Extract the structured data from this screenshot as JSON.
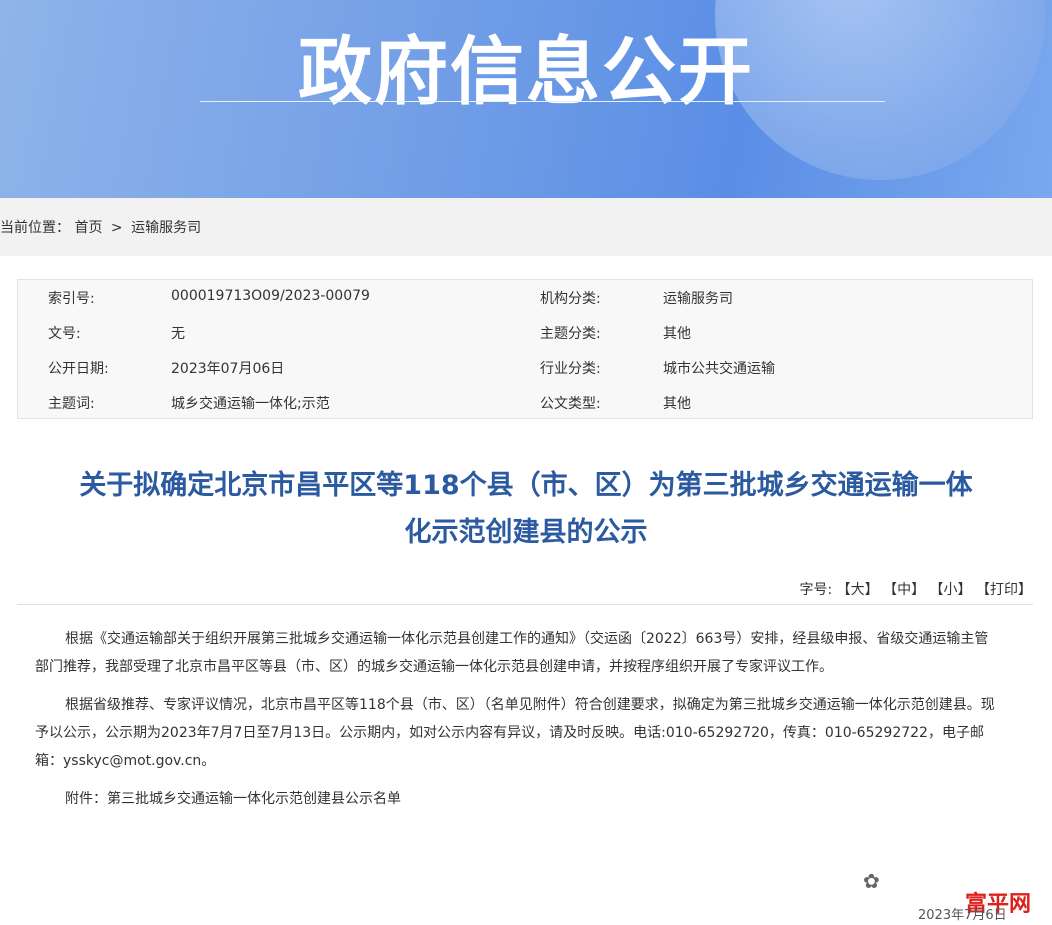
{
  "banner": {
    "title": "政府信息公开"
  },
  "breadcrumb": {
    "prefix": "当前位置：",
    "home": "首页",
    "separator": ">",
    "section": "运输服务司"
  },
  "meta": [
    {
      "k1": "索引号:",
      "v1": "000019713O09/2023-00079",
      "k2": "机构分类:",
      "v2": "运输服务司"
    },
    {
      "k1": "文号:",
      "v1": "无",
      "k2": "主题分类:",
      "v2": "其他"
    },
    {
      "k1": "公开日期:",
      "v1": "2023年07月06日",
      "k2": "行业分类:",
      "v2": "城市公共交通运输"
    },
    {
      "k1": "主题词:",
      "v1": "城乡交通运输一体化;示范",
      "k2": "公文类型:",
      "v2": "其他"
    }
  ],
  "article": {
    "title_line1": "关于拟确定北京市昌平区等118个县（市、区）为第三批城乡交通运输一体",
    "title_line2": "化示范创建县的公示",
    "font_label": "字号:",
    "font_large": "【大】",
    "font_medium": "【中】",
    "font_small": "【小】",
    "print": "【打印】",
    "para1": "根据《交通运输部关于组织开展第三批城乡交通运输一体化示范县创建工作的通知》（交运函〔2022〕663号）安排，经县级申报、省级交通运输主管部门推荐，我部受理了北京市昌平区等县（市、区）的城乡交通运输一体化示范县创建申请，并按程序组织开展了专家评议工作。",
    "para2": "根据省级推荐、专家评议情况，北京市昌平区等118个县（市、区）（名单见附件）符合创建要求，拟确定为第三批城乡交通运输一体化示范创建县。现予以公示，公示期为2023年7月7日至7月13日。公示期内，如对公示内容有异议，请及时反映。电话:010-65292720，传真：010-65292722，电子邮箱：ysskyc@mot.gov.cn。",
    "attachment": "附件：第三批城乡交通运输一体化示范创建县公示名单"
  },
  "watermark": {
    "text": "富平网",
    "date": "2023年7月6日"
  }
}
